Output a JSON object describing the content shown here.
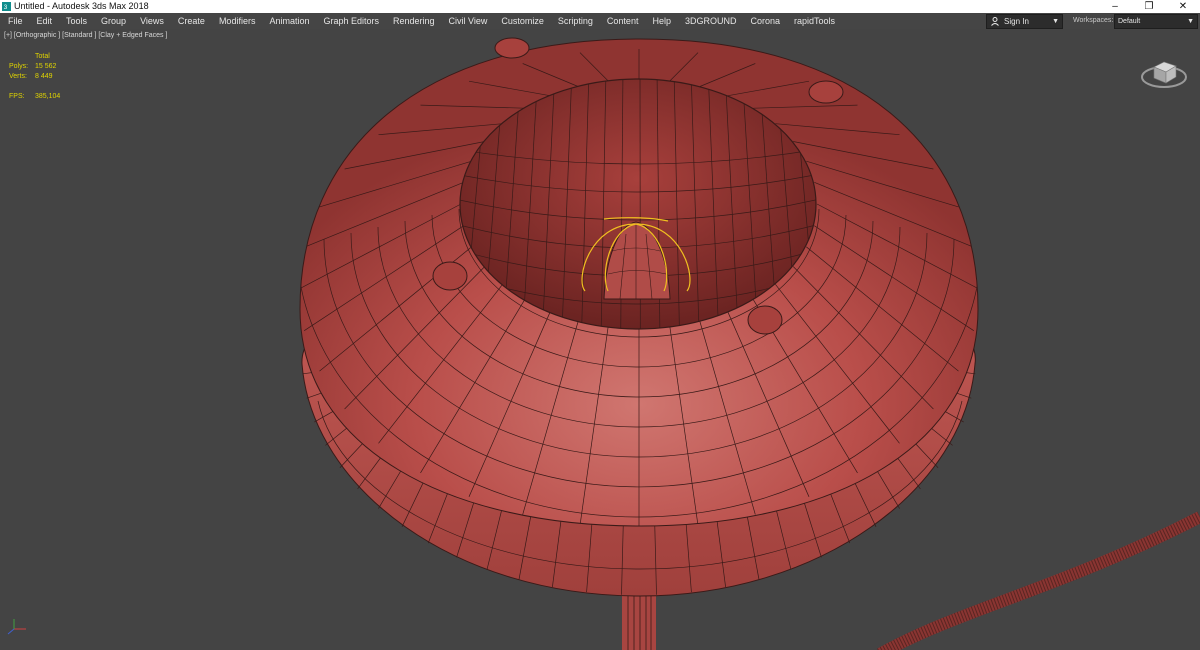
{
  "window": {
    "title": "Untitled - Autodesk 3ds Max 2018",
    "controls": {
      "minimize": "–",
      "restore": "❐",
      "close": "✕"
    }
  },
  "menubar": {
    "items": [
      "File",
      "Edit",
      "Tools",
      "Group",
      "Views",
      "Create",
      "Modifiers",
      "Animation",
      "Graph Editors",
      "Rendering",
      "Civil View",
      "Customize",
      "Scripting",
      "Content",
      "Help",
      "3DGROUND",
      "Corona",
      "rapidTools"
    ],
    "sign_in": "Sign In",
    "workspaces_label": "Workspaces:",
    "workspaces_value": "Default"
  },
  "viewport": {
    "label": "[+] [Orthographic ] [Standard ] [Clay + Edged Faces ]",
    "stats": {
      "header": "Total",
      "polys_label": "Polys:",
      "polys_value": "15 562",
      "verts_label": "Verts:",
      "verts_value": "8 449",
      "fps_label": "FPS:",
      "fps_value": "385,104"
    }
  },
  "colors": {
    "viewport_bg": "#444444",
    "clay": "#b84c48",
    "wire": "#3a1a18",
    "selection": "#f0c020",
    "stats_text": "#e0d400"
  }
}
